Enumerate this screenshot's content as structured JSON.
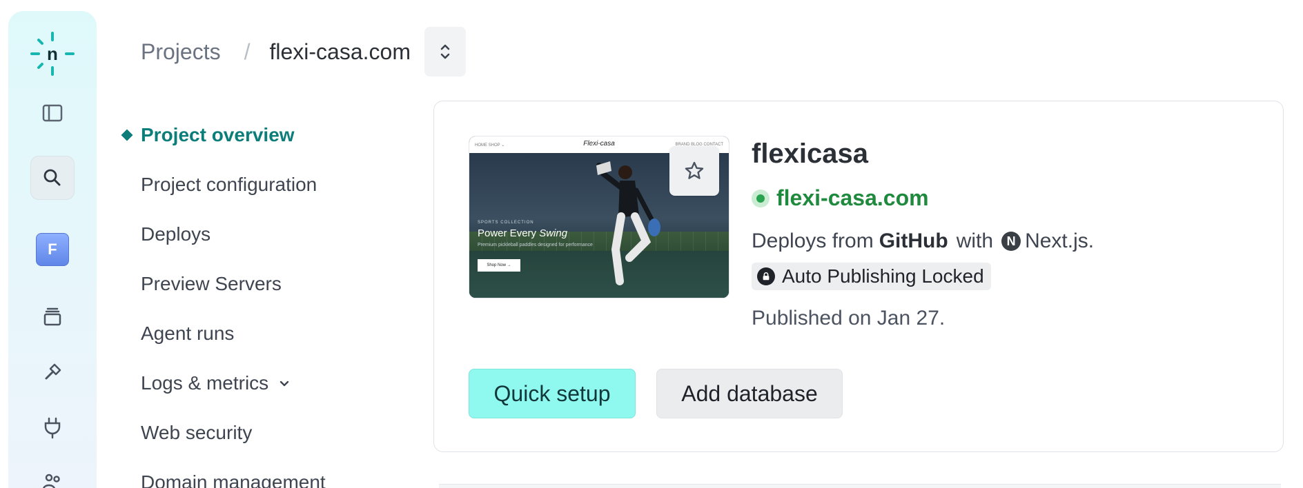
{
  "app": {
    "name": "Netlify",
    "logo_letter": "n"
  },
  "rail": {
    "avatar_letter": "F",
    "icons": [
      "sidebar-toggle-icon",
      "search-icon",
      "layers-icon",
      "hammer-icon",
      "plug-icon",
      "team-icon"
    ]
  },
  "breadcrumb": {
    "root": "Projects",
    "separator": "/",
    "current": "flexi-casa.com"
  },
  "nav": {
    "items": [
      {
        "label": "Project overview",
        "active": true
      },
      {
        "label": "Project configuration"
      },
      {
        "label": "Deploys"
      },
      {
        "label": "Preview Servers"
      },
      {
        "label": "Agent runs"
      },
      {
        "label": "Logs & metrics",
        "has_caret": true
      },
      {
        "label": "Web security"
      },
      {
        "label": "Domain management"
      }
    ]
  },
  "project": {
    "name": "flexicasa",
    "url": "flexi-casa.com",
    "deploy_prefix": "Deploys from",
    "deploy_source": "GitHub",
    "deploy_with": "with",
    "framework": "Next.js.",
    "framework_badge": "N",
    "lock_label": "Auto Publishing Locked",
    "published": "Published on Jan 27."
  },
  "thumbnail": {
    "brand": "Flexi-casa",
    "nav_left": "HOME    SHOP ⌄",
    "nav_right": "BRAND   BLOG   CONTACT",
    "eyebrow": "SPORTS COLLECTION",
    "title_plain": "Power Every ",
    "title_em": "Swing",
    "subtitle": "Premium pickleball paddles designed for performance",
    "cta": "Shop Now →"
  },
  "actions": {
    "primary": "Quick setup",
    "secondary": "Add database"
  },
  "colors": {
    "accent": "#0d7d7a",
    "status_green": "#1f8a3d",
    "primary_button": "#8ff8ef"
  }
}
